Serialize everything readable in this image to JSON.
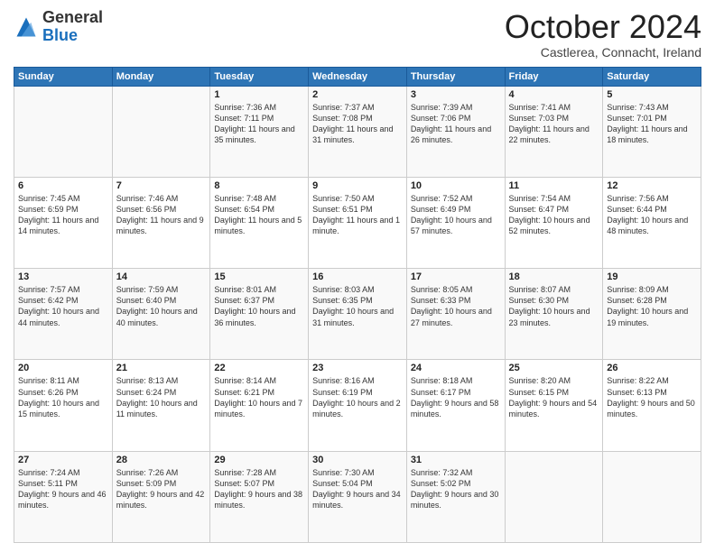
{
  "header": {
    "logo": {
      "line1": "General",
      "line2": "Blue"
    },
    "title": "October 2024",
    "subtitle": "Castlerea, Connacht, Ireland"
  },
  "weekdays": [
    "Sunday",
    "Monday",
    "Tuesday",
    "Wednesday",
    "Thursday",
    "Friday",
    "Saturday"
  ],
  "weeks": [
    [
      {
        "day": "",
        "sunrise": "",
        "sunset": "",
        "daylight": ""
      },
      {
        "day": "",
        "sunrise": "",
        "sunset": "",
        "daylight": ""
      },
      {
        "day": "1",
        "sunrise": "Sunrise: 7:36 AM",
        "sunset": "Sunset: 7:11 PM",
        "daylight": "Daylight: 11 hours and 35 minutes."
      },
      {
        "day": "2",
        "sunrise": "Sunrise: 7:37 AM",
        "sunset": "Sunset: 7:08 PM",
        "daylight": "Daylight: 11 hours and 31 minutes."
      },
      {
        "day": "3",
        "sunrise": "Sunrise: 7:39 AM",
        "sunset": "Sunset: 7:06 PM",
        "daylight": "Daylight: 11 hours and 26 minutes."
      },
      {
        "day": "4",
        "sunrise": "Sunrise: 7:41 AM",
        "sunset": "Sunset: 7:03 PM",
        "daylight": "Daylight: 11 hours and 22 minutes."
      },
      {
        "day": "5",
        "sunrise": "Sunrise: 7:43 AM",
        "sunset": "Sunset: 7:01 PM",
        "daylight": "Daylight: 11 hours and 18 minutes."
      }
    ],
    [
      {
        "day": "6",
        "sunrise": "Sunrise: 7:45 AM",
        "sunset": "Sunset: 6:59 PM",
        "daylight": "Daylight: 11 hours and 14 minutes."
      },
      {
        "day": "7",
        "sunrise": "Sunrise: 7:46 AM",
        "sunset": "Sunset: 6:56 PM",
        "daylight": "Daylight: 11 hours and 9 minutes."
      },
      {
        "day": "8",
        "sunrise": "Sunrise: 7:48 AM",
        "sunset": "Sunset: 6:54 PM",
        "daylight": "Daylight: 11 hours and 5 minutes."
      },
      {
        "day": "9",
        "sunrise": "Sunrise: 7:50 AM",
        "sunset": "Sunset: 6:51 PM",
        "daylight": "Daylight: 11 hours and 1 minute."
      },
      {
        "day": "10",
        "sunrise": "Sunrise: 7:52 AM",
        "sunset": "Sunset: 6:49 PM",
        "daylight": "Daylight: 10 hours and 57 minutes."
      },
      {
        "day": "11",
        "sunrise": "Sunrise: 7:54 AM",
        "sunset": "Sunset: 6:47 PM",
        "daylight": "Daylight: 10 hours and 52 minutes."
      },
      {
        "day": "12",
        "sunrise": "Sunrise: 7:56 AM",
        "sunset": "Sunset: 6:44 PM",
        "daylight": "Daylight: 10 hours and 48 minutes."
      }
    ],
    [
      {
        "day": "13",
        "sunrise": "Sunrise: 7:57 AM",
        "sunset": "Sunset: 6:42 PM",
        "daylight": "Daylight: 10 hours and 44 minutes."
      },
      {
        "day": "14",
        "sunrise": "Sunrise: 7:59 AM",
        "sunset": "Sunset: 6:40 PM",
        "daylight": "Daylight: 10 hours and 40 minutes."
      },
      {
        "day": "15",
        "sunrise": "Sunrise: 8:01 AM",
        "sunset": "Sunset: 6:37 PM",
        "daylight": "Daylight: 10 hours and 36 minutes."
      },
      {
        "day": "16",
        "sunrise": "Sunrise: 8:03 AM",
        "sunset": "Sunset: 6:35 PM",
        "daylight": "Daylight: 10 hours and 31 minutes."
      },
      {
        "day": "17",
        "sunrise": "Sunrise: 8:05 AM",
        "sunset": "Sunset: 6:33 PM",
        "daylight": "Daylight: 10 hours and 27 minutes."
      },
      {
        "day": "18",
        "sunrise": "Sunrise: 8:07 AM",
        "sunset": "Sunset: 6:30 PM",
        "daylight": "Daylight: 10 hours and 23 minutes."
      },
      {
        "day": "19",
        "sunrise": "Sunrise: 8:09 AM",
        "sunset": "Sunset: 6:28 PM",
        "daylight": "Daylight: 10 hours and 19 minutes."
      }
    ],
    [
      {
        "day": "20",
        "sunrise": "Sunrise: 8:11 AM",
        "sunset": "Sunset: 6:26 PM",
        "daylight": "Daylight: 10 hours and 15 minutes."
      },
      {
        "day": "21",
        "sunrise": "Sunrise: 8:13 AM",
        "sunset": "Sunset: 6:24 PM",
        "daylight": "Daylight: 10 hours and 11 minutes."
      },
      {
        "day": "22",
        "sunrise": "Sunrise: 8:14 AM",
        "sunset": "Sunset: 6:21 PM",
        "daylight": "Daylight: 10 hours and 7 minutes."
      },
      {
        "day": "23",
        "sunrise": "Sunrise: 8:16 AM",
        "sunset": "Sunset: 6:19 PM",
        "daylight": "Daylight: 10 hours and 2 minutes."
      },
      {
        "day": "24",
        "sunrise": "Sunrise: 8:18 AM",
        "sunset": "Sunset: 6:17 PM",
        "daylight": "Daylight: 9 hours and 58 minutes."
      },
      {
        "day": "25",
        "sunrise": "Sunrise: 8:20 AM",
        "sunset": "Sunset: 6:15 PM",
        "daylight": "Daylight: 9 hours and 54 minutes."
      },
      {
        "day": "26",
        "sunrise": "Sunrise: 8:22 AM",
        "sunset": "Sunset: 6:13 PM",
        "daylight": "Daylight: 9 hours and 50 minutes."
      }
    ],
    [
      {
        "day": "27",
        "sunrise": "Sunrise: 7:24 AM",
        "sunset": "Sunset: 5:11 PM",
        "daylight": "Daylight: 9 hours and 46 minutes."
      },
      {
        "day": "28",
        "sunrise": "Sunrise: 7:26 AM",
        "sunset": "Sunset: 5:09 PM",
        "daylight": "Daylight: 9 hours and 42 minutes."
      },
      {
        "day": "29",
        "sunrise": "Sunrise: 7:28 AM",
        "sunset": "Sunset: 5:07 PM",
        "daylight": "Daylight: 9 hours and 38 minutes."
      },
      {
        "day": "30",
        "sunrise": "Sunrise: 7:30 AM",
        "sunset": "Sunset: 5:04 PM",
        "daylight": "Daylight: 9 hours and 34 minutes."
      },
      {
        "day": "31",
        "sunrise": "Sunrise: 7:32 AM",
        "sunset": "Sunset: 5:02 PM",
        "daylight": "Daylight: 9 hours and 30 minutes."
      },
      {
        "day": "",
        "sunrise": "",
        "sunset": "",
        "daylight": ""
      },
      {
        "day": "",
        "sunrise": "",
        "sunset": "",
        "daylight": ""
      }
    ]
  ]
}
